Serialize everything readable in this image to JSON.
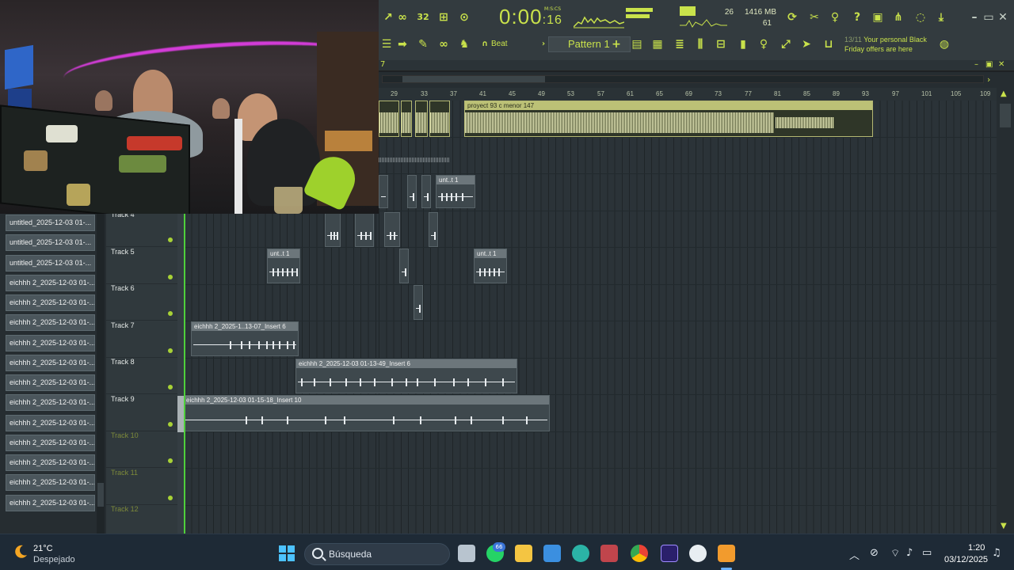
{
  "fl": {
    "time_main": "0:00",
    "time_small": "16",
    "time_unit": "M:S:CS",
    "memory": "1416 MB",
    "cpu": "26",
    "polyphony": "61",
    "pattern_label": "Pattern 1",
    "snap_label": "Beat",
    "promo_count": "13/11",
    "promo_text": "Your personal Black Friday offers are here",
    "playlist_number": "7",
    "accent": "#c9e24b"
  },
  "ruler": [
    "29",
    "33",
    "37",
    "41",
    "45",
    "49",
    "53",
    "57",
    "61",
    "65",
    "69",
    "73",
    "77",
    "81",
    "85",
    "89",
    "93",
    "97",
    "101",
    "105",
    "109"
  ],
  "browser_items": [
    "untitled_2025-12-03 01-...",
    "untitled_2025-12-03 01-...",
    "untitled_2025-12-03 01-...",
    "eichhh 2_2025-12-03 01-...",
    "eichhh 2_2025-12-03 01-...",
    "eichhh 2_2025-12-03 01-...",
    "eichhh 2_2025-12-03 01-...",
    "eichhh 2_2025-12-03 01-...",
    "eichhh 2_2025-12-03 01-...",
    "eichhh 2_2025-12-03 01-...",
    "eichhh 2_2025-12-03 01-...",
    "eichhh 2_2025-12-03 01-...",
    "eichhh 2_2025-12-03 01-...",
    "eichhh 2_2025-12-03 01-...",
    "eichhh 2_2025-12-03 01-..."
  ],
  "tracks": [
    "Track 4",
    "Track 5",
    "Track 6",
    "Track 7",
    "Track 8",
    "Track 9",
    "Track 10",
    "Track 11",
    "Track 12"
  ],
  "clips": {
    "top_yellow": "proyect 93 c menor 147",
    "small_t": "unt..t 1",
    "t3_a": "unt..t 1",
    "t5_a": "unt..t 1",
    "t5_b": "unt..t 1",
    "t7": "eichhh 2_2025-1..13-07_Insert 6",
    "t8": "eichhh 2_2025-12-03 01-13-49_Insert 6",
    "t9": "eichhh 2_2025-12-03 01-15-18_Insert 10"
  },
  "taskbar": {
    "temp": "21°C",
    "weather": "Despejado",
    "search": "Búsqueda",
    "badge": "66",
    "time": "1:20",
    "date": "03/12/2025"
  }
}
